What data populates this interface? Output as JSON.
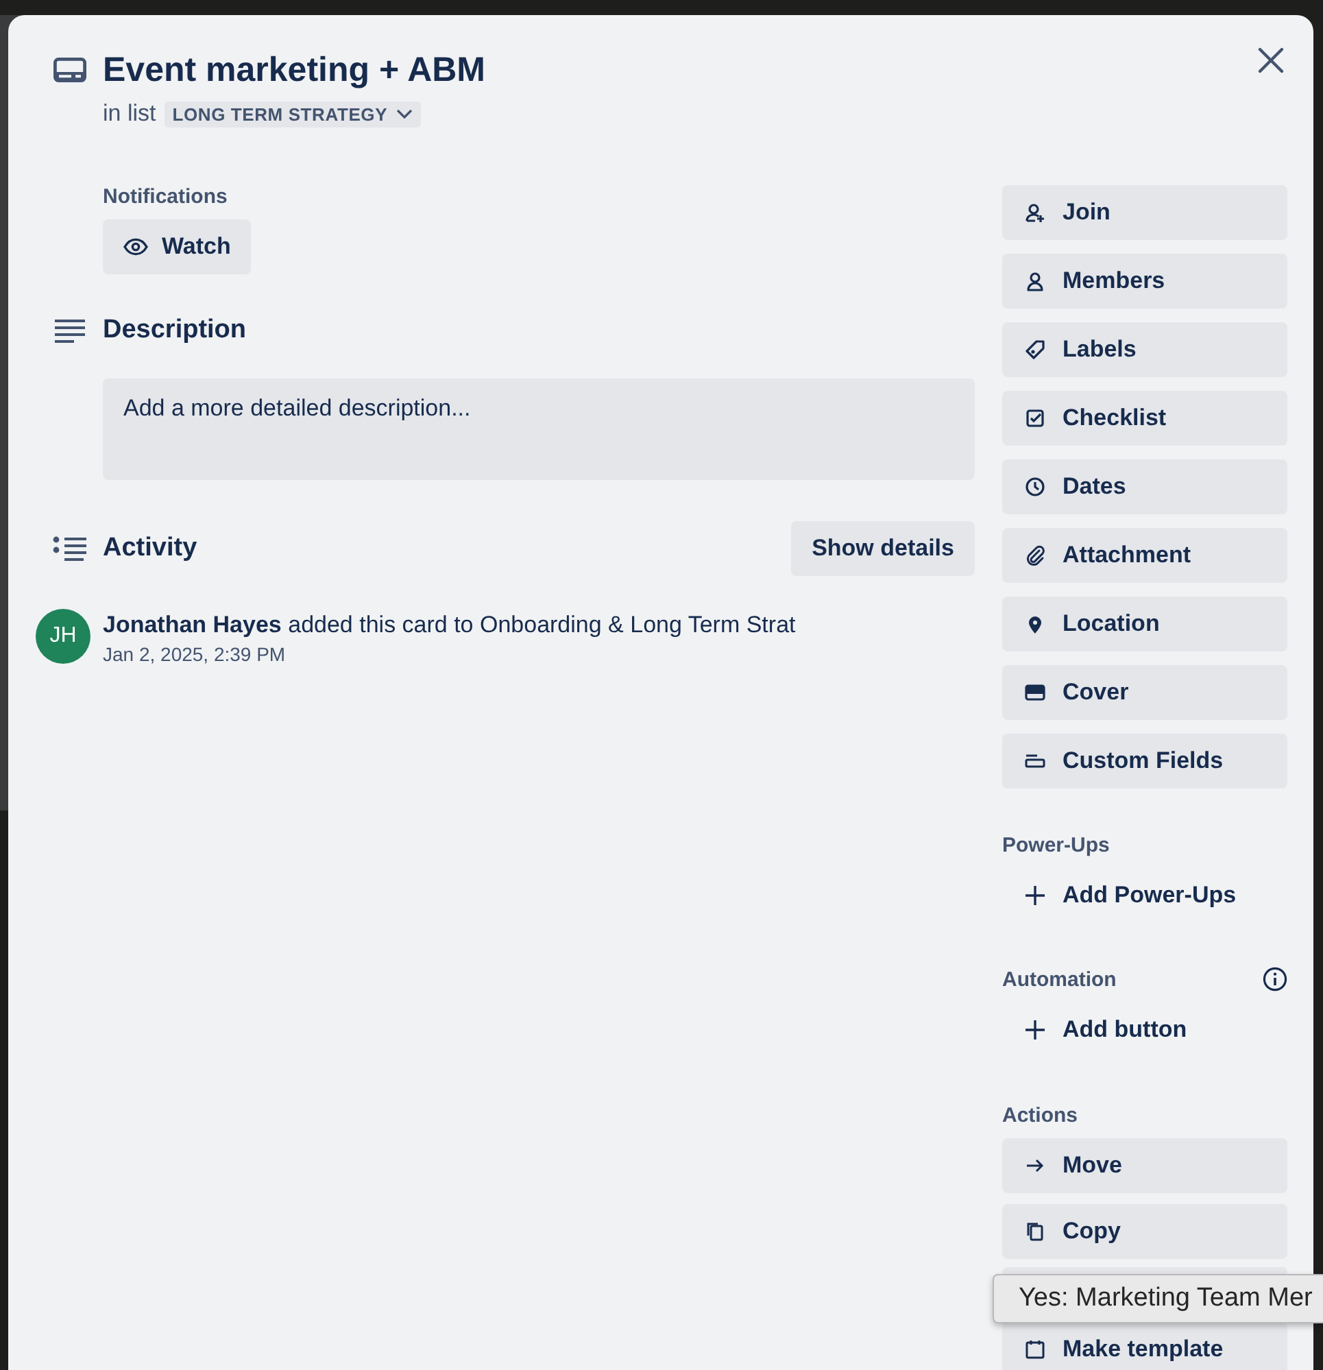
{
  "card": {
    "title": "Event marketing + ABM",
    "list_prefix": "in list",
    "list_name": "LONG TERM STRATEGY"
  },
  "notifications": {
    "heading": "Notifications",
    "watch_label": "Watch"
  },
  "description": {
    "heading": "Description",
    "prompt": "Add a more detailed description..."
  },
  "activity": {
    "heading": "Activity",
    "toggle_label": "Show details",
    "entries": [
      {
        "initials": "JH",
        "text": "**Jonathan Hayes** added this card to Onboarding & Long Term Strat",
        "time": "Jan 2, 2025, 2:39 PM"
      }
    ]
  },
  "sidebar": {
    "buttons": [
      {
        "kind": "join",
        "label": "Join"
      },
      {
        "kind": "members",
        "label": "Members"
      },
      {
        "kind": "labels",
        "label": "Labels"
      },
      {
        "kind": "checklist",
        "label": "Checklist"
      },
      {
        "kind": "dates",
        "label": "Dates"
      },
      {
        "kind": "attachment",
        "label": "Attachment"
      },
      {
        "kind": "location",
        "label": "Location"
      },
      {
        "kind": "cover",
        "label": "Cover"
      },
      {
        "kind": "custom-fields",
        "label": "Custom Fields"
      }
    ]
  },
  "power_ups": {
    "heading": "Power-Ups",
    "add_label": "Add Power-Ups"
  },
  "automation": {
    "heading": "Automation",
    "add_label": "Add button"
  },
  "actions": {
    "heading": "Actions",
    "buttons": [
      {
        "kind": "move",
        "label": "Move"
      },
      {
        "kind": "copy",
        "label": "Copy"
      },
      {
        "kind": "covered"
      },
      {
        "kind": "template",
        "label": "Make template"
      }
    ]
  },
  "tooltip": {
    "text": "Yes: Marketing Team Mer"
  }
}
